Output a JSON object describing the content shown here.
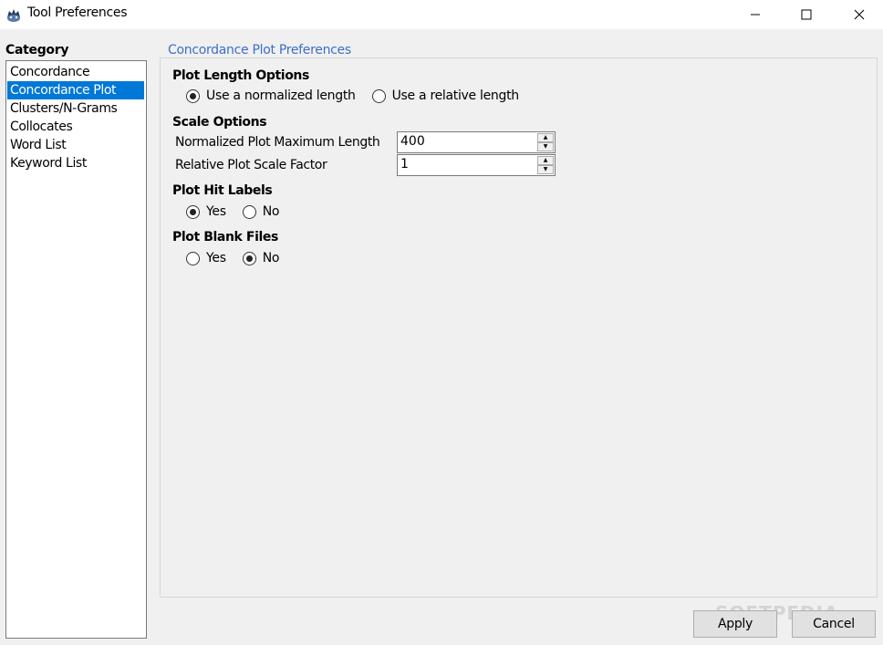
{
  "window": {
    "title": "Tool Preferences",
    "icon": "antconc-icon"
  },
  "sidebar": {
    "label": "Category",
    "items": [
      {
        "label": "Concordance",
        "selected": false
      },
      {
        "label": "Concordance Plot",
        "selected": true
      },
      {
        "label": "Clusters/N-Grams",
        "selected": false
      },
      {
        "label": "Collocates",
        "selected": false
      },
      {
        "label": "Word List",
        "selected": false
      },
      {
        "label": "Keyword List",
        "selected": false
      }
    ]
  },
  "panel": {
    "legend": "Concordance Plot Preferences",
    "plot_length": {
      "heading": "Plot Length Options",
      "options": [
        {
          "label": "Use a normalized length",
          "checked": true
        },
        {
          "label": "Use a relative length",
          "checked": false
        }
      ]
    },
    "scale": {
      "heading": "Scale Options",
      "normalized_label": "Normalized Plot Maximum Length",
      "normalized_value": "400",
      "relative_label": "Relative Plot Scale Factor",
      "relative_value": "1"
    },
    "hit_labels": {
      "heading": "Plot Hit Labels",
      "options": [
        {
          "label": "Yes",
          "checked": true
        },
        {
          "label": "No",
          "checked": false
        }
      ]
    },
    "blank_files": {
      "heading": "Plot Blank Files",
      "options": [
        {
          "label": "Yes",
          "checked": false
        },
        {
          "label": "No",
          "checked": true
        }
      ]
    }
  },
  "buttons": {
    "apply": "Apply",
    "cancel": "Cancel"
  },
  "watermark": "SOFTPEDIA",
  "colors": {
    "selection": "#0078d7",
    "legend": "#3c6fc8",
    "background": "#f0f0f0"
  }
}
